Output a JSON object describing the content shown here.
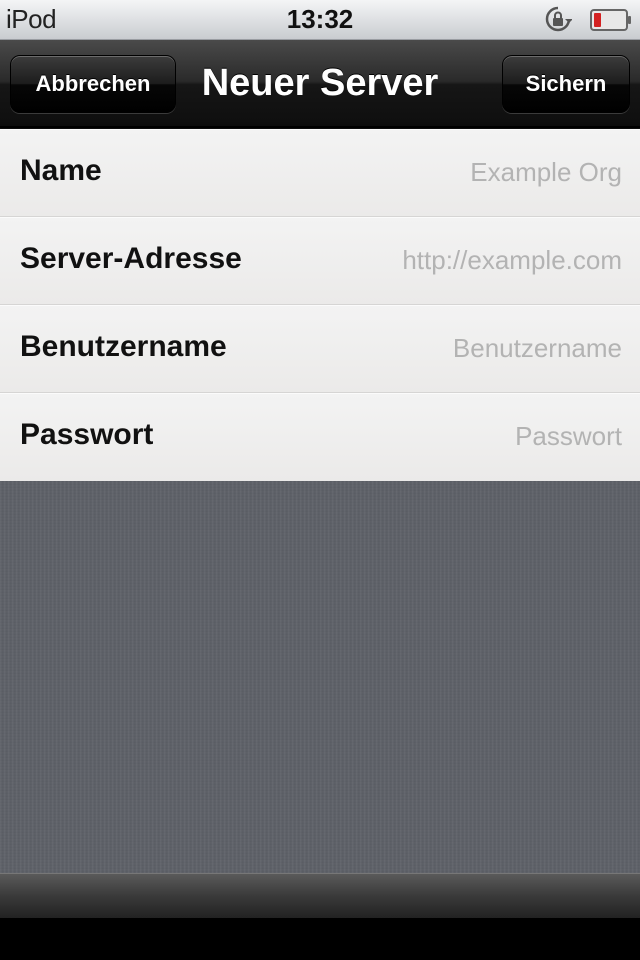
{
  "status_bar": {
    "carrier": "iPod",
    "time": "13:32",
    "icons": [
      "rotation-lock-icon",
      "battery-icon"
    ],
    "battery_color": "#d42222"
  },
  "nav_bar": {
    "title": "Neuer Server",
    "cancel_label": "Abbrechen",
    "save_label": "Sichern"
  },
  "form": {
    "fields": [
      {
        "label": "Name",
        "value": "",
        "placeholder": "Example Org"
      },
      {
        "label": "Server-Adresse",
        "value": "",
        "placeholder": "http://example.com"
      },
      {
        "label": "Benutzername",
        "value": "",
        "placeholder": "Benutzername"
      },
      {
        "label": "Passwort",
        "value": "",
        "placeholder": "Passwort"
      }
    ]
  },
  "colors": {
    "nav_background": "#1c1c1c",
    "row_background": "#efefee",
    "placeholder": "#b3b3b3",
    "content_background": "#5f6269"
  }
}
